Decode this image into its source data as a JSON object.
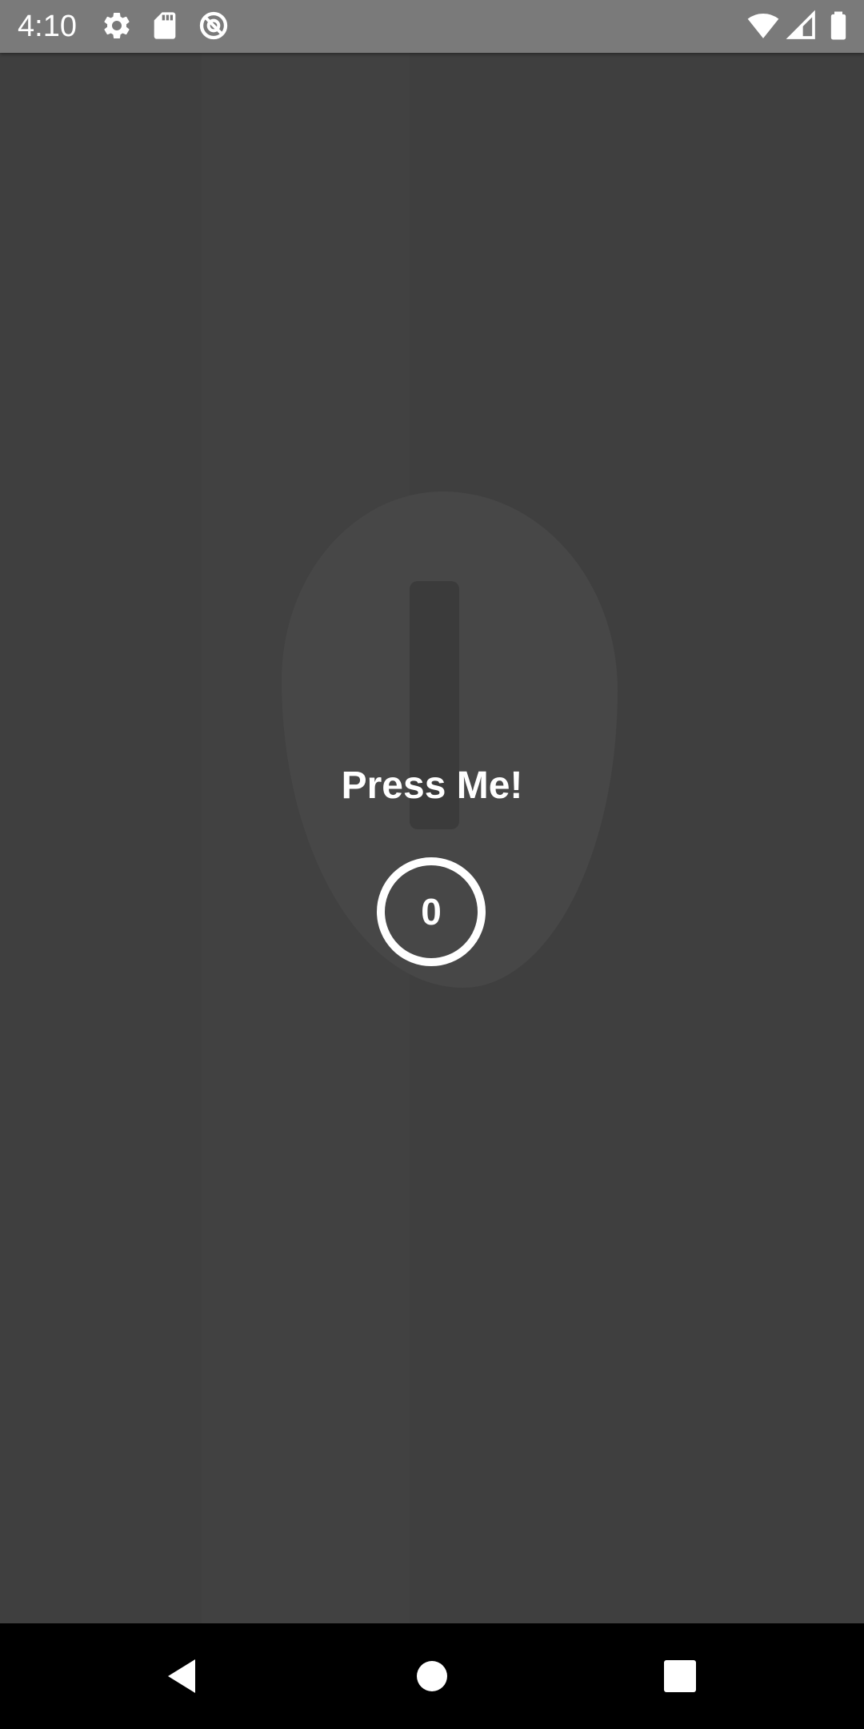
{
  "status_bar": {
    "time": "4:10",
    "left_icons": [
      "settings-icon",
      "sd-card-icon",
      "data-saver-icon"
    ],
    "right_icons": [
      "wifi-icon",
      "cellular-signal-icon",
      "battery-icon"
    ],
    "background_color": "#7a7a7a",
    "icon_color": "#ffffff"
  },
  "app": {
    "background_color": "#3f3f3f",
    "title": "Press Me!",
    "counter": "0",
    "text_color": "#ffffff"
  },
  "nav_bar": {
    "background_color": "#000000",
    "buttons": [
      "back-icon",
      "home-icon",
      "recents-icon"
    ]
  }
}
